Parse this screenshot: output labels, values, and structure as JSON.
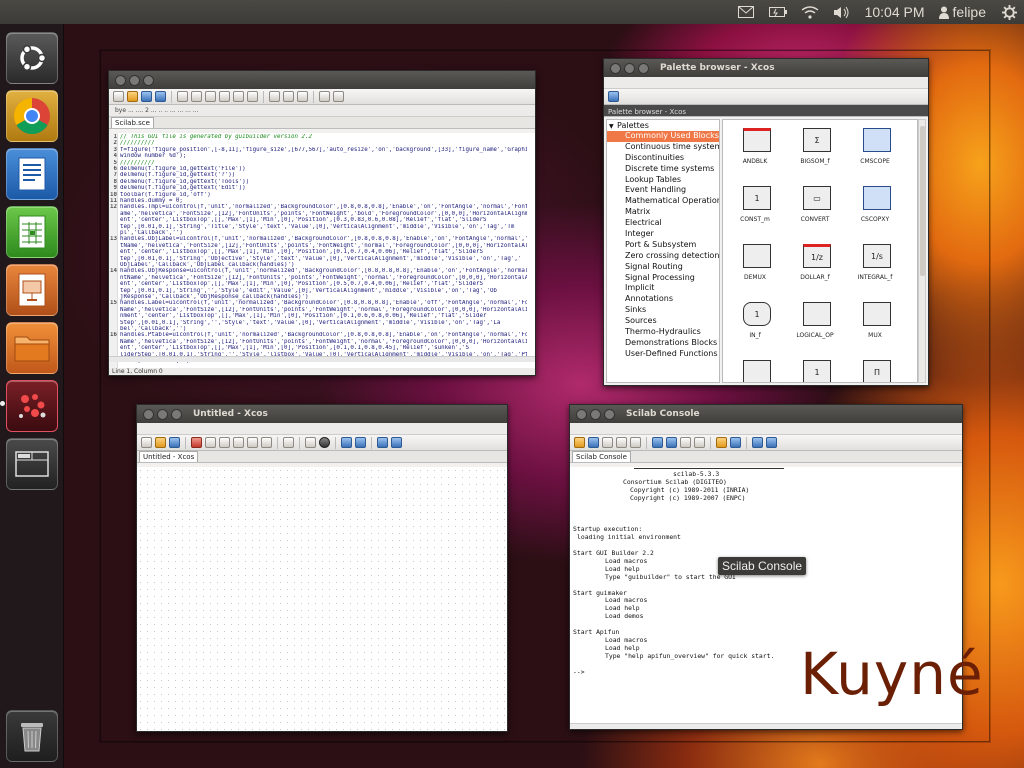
{
  "top_panel": {
    "clock": "10:04 PM",
    "user": "felipe",
    "indicators": [
      "mail-icon",
      "battery-icon",
      "wifi-icon",
      "volume-icon",
      "gear-icon"
    ]
  },
  "launcher": {
    "items": [
      "ubuntu-dash",
      "chromium",
      "libreoffice-writer",
      "libreoffice-calc",
      "libreoffice-impress",
      "files",
      "scilab",
      "workspace-switcher",
      "trash"
    ]
  },
  "scinotes": {
    "tab_label": "Scilab.sce",
    "path_text": "bye ... .... 2 ... .. .. ... ... ... ...",
    "status": "Line 1, Column 0",
    "lines": [
      {
        "n": "1",
        "text": "// This GUI file is generated by guibuilder version 2.2",
        "comment": true
      },
      {
        "n": "2",
        "text": "//////////",
        "comment": true
      },
      {
        "n": "3",
        "text": "f=figure('figure_position',[-8,11],'figure_size',[677,567],'auto_resize','on','background',[33],'figure_name','Graphic",
        "comment": false
      },
      {
        "n": "4",
        "text": "window number %d');",
        "comment": false
      },
      {
        "n": "5",
        "text": "//////////",
        "comment": true
      },
      {
        "n": "6",
        "text": "delmenu(f.figure_id,gettext('File'))",
        "comment": false
      },
      {
        "n": "7",
        "text": "delmenu(f.figure_id,gettext('?'))",
        "comment": false
      },
      {
        "n": "8",
        "text": "delmenu(f.figure_id,gettext('Tools'))",
        "comment": false
      },
      {
        "n": "9",
        "text": "delmenu(f.figure_id,gettext('Edit'))",
        "comment": false
      },
      {
        "n": "10",
        "text": "toolbar(f.figure_id,'off')",
        "comment": false
      },
      {
        "n": "11",
        "text": "handles.dummy = 0;",
        "comment": false
      },
      {
        "n": "12",
        "text": "handles.Tmpl=uicontrol(f,'unit','normalized','BackgroundColor',[0.8,0.8,0.8],'Enable','on','FontAngle','normal','FontN",
        "comment": false
      },
      {
        "n": "",
        "text": "ame','helvetica','FontSize',[12],'FontUnits','points','FontWeight','bold','ForegroundColor',[0,0,0],'HorizontalAlignm",
        "comment": false
      },
      {
        "n": "",
        "text": "ent','center','ListboxTop',[],'Max',[1],'Min',[0],'Position',[0.3,0.83,0.6,0.08],'Relief','flat','SliderS",
        "comment": false
      },
      {
        "n": "",
        "text": "tep',[0.01,0.1],'String','Title','Style','text','Value',[0],'VerticalAlignment','middle','Visible','on','Tag','Tm",
        "comment": false
      },
      {
        "n": "",
        "text": "pl','Callback','')",
        "comment": false
      },
      {
        "n": "13",
        "text": "handles.ObjLabel=uicontrol(f,'unit','normalized','BackgroundColor',[0.8,0.8,0.8],'Enable','on','FontAngle','normal','Fon",
        "comment": false
      },
      {
        "n": "",
        "text": "tName','helvetica','FontSize',[12],'FontUnits','points','FontWeight','normal','ForegroundColor',[0,0,0],'HorizontalAlignm",
        "comment": false
      },
      {
        "n": "",
        "text": "ent','center','ListboxTop',[],'Max',[1],'Min',[0],'Position',[0.1,0.7,0.4,0.06],'Relief','flat','SliderS",
        "comment": false
      },
      {
        "n": "",
        "text": "tep',[0.01,0.1],'String','Objective','Style','text','Value',[0],'VerticalAlignment','middle','Visible','on','Tag','",
        "comment": false
      },
      {
        "n": "",
        "text": "ObjLabel','Callback','ObjLabel_callback(handles)')",
        "comment": false
      },
      {
        "n": "14",
        "text": "handles.ObjResponse=uicontrol(f,'unit','normalized','BackgroundColor',[0.8,0.8,0.8],'Enable','on','FontAngle','normal','Fo",
        "comment": false
      },
      {
        "n": "",
        "text": "ntName','helvetica','FontSize',[12],'FontUnits','points','FontWeight','normal','ForegroundColor',[0,0,0],'HorizontalAlignm",
        "comment": false
      },
      {
        "n": "",
        "text": "ent','center','ListboxTop',[],'Max',[1],'Min',[0],'Position',[0.5,0.7,0.4,0.06],'Relief','flat','SliderS",
        "comment": false
      },
      {
        "n": "",
        "text": "tep',[0.01,0.1],'String','','Style','edit','Value',[0],'VerticalAlignment','middle','Visible','on','Tag','Ob",
        "comment": false
      },
      {
        "n": "",
        "text": "jResponse','Callback','ObjResponse_callback(handles)')",
        "comment": false
      },
      {
        "n": "15",
        "text": "handles.Label=uicontrol(f,'unit','normalized','BackgroundColor',[0.8,0.8,0.8],'Enable','off','FontAngle','normal','Font",
        "comment": false
      },
      {
        "n": "",
        "text": "Name','helvetica','FontSize',[12],'FontUnits','points','FontWeight','normal','ForegroundColor',[0,0,0],'HorizontalAlig",
        "comment": false
      },
      {
        "n": "",
        "text": "nment','center','ListboxTop',[],'Max',[1],'Min',[0],'Position',[0.1,0.6,0.8,0.06],'Relief','flat','Slider",
        "comment": false
      },
      {
        "n": "",
        "text": "Step',[0.01,0.1],'String','','Style','text','Value',[0],'VerticalAlignment','middle','Visible','on','Tag','La",
        "comment": false
      },
      {
        "n": "",
        "text": "bel','Callback','')",
        "comment": false
      },
      {
        "n": "16",
        "text": "handles.Ptable=uicontrol(f,'unit','normalized','BackgroundColor',[0.8,0.8,0.8],'Enable','on','FontAngle','normal','Font",
        "comment": false
      },
      {
        "n": "",
        "text": "Name','helvetica','FontSize',[12],'FontUnits','points','FontWeight','normal','ForegroundColor',[0,0,0],'HorizontalAlignm",
        "comment": false
      },
      {
        "n": "",
        "text": "ent','center','ListboxTop',[],'Max',[1],'Min',[0],'Position',[0.1,0.1,0.8,0.45],'Relief','sunken','S",
        "comment": false
      },
      {
        "n": "",
        "text": "liderStep',[0.01,0.1],'String','','Style','listbox','Value',[0],'VerticalAlignment','middle','Visible','on','Tag','Pt",
        "comment": false
      },
      {
        "n": "",
        "text": "able','Callback','')",
        "comment": false
      }
    ]
  },
  "palette": {
    "title": "Palette browser - Xcos",
    "breadcrumb": "Palette browser - Xcos",
    "tree_root": "Palettes",
    "tree_items": [
      "Commonly Used Blocks",
      "Continuous time systems",
      "Discontinuities",
      "Discrete time systems",
      "Lookup Tables",
      "Event Handling",
      "Mathematical Operations",
      "Matrix",
      "Electrical",
      "Integer",
      "Port & Subsystem",
      "Zero crossing detection",
      "Signal Routing",
      "Signal Processing",
      "Implicit",
      "Annotations",
      "Sinks",
      "Sources",
      "Thermo-Hydraulics",
      "Demonstrations Blocks",
      "User-Defined Functions"
    ],
    "blocks": [
      {
        "name": "ANDBLK",
        "glyph": ""
      },
      {
        "name": "BIGSOM_f",
        "glyph": "Σ"
      },
      {
        "name": "CMSCOPE",
        "glyph": ""
      },
      {
        "name": "CONST_m",
        "glyph": "1"
      },
      {
        "name": "CONVERT",
        "glyph": "▭"
      },
      {
        "name": "CSCOPXY",
        "glyph": ""
      },
      {
        "name": "DEMUX",
        "glyph": ""
      },
      {
        "name": "DOLLAR_f",
        "glyph": "1/z"
      },
      {
        "name": "INTEGRAL_f",
        "glyph": "1/s"
      },
      {
        "name": "IN_f",
        "glyph": "1"
      },
      {
        "name": "LOGICAL_OP",
        "glyph": ""
      },
      {
        "name": "MUX",
        "glyph": ""
      },
      {
        "name": "",
        "glyph": ""
      },
      {
        "name": "",
        "glyph": "1"
      },
      {
        "name": "",
        "glyph": "Π"
      }
    ]
  },
  "xcos": {
    "title": "Untitled - Xcos",
    "tab_label": "Untitled - Xcos"
  },
  "console": {
    "title": "Scilab Console",
    "tab_label": "Scilab Console",
    "tooltip": "Scilab Console",
    "lines": [
      {
        "col": 100,
        "text": "scilab-5.3.3"
      },
      {
        "col": 50,
        "text": "Consortium Scilab (DIGITEO)"
      },
      {
        "col": 57,
        "text": "Copyright (c) 1989-2011 (INRIA)"
      },
      {
        "col": 57,
        "text": "Copyright (c) 1989-2007 (ENPC)"
      },
      {
        "col": 0,
        "text": ""
      },
      {
        "col": 0,
        "text": ""
      },
      {
        "col": 0,
        "text": ""
      },
      {
        "col": 0,
        "text": "Startup execution:"
      },
      {
        "col": 4,
        "text": "loading initial environment"
      },
      {
        "col": 0,
        "text": ""
      },
      {
        "col": 0,
        "text": "Start GUI Builder 2.2"
      },
      {
        "col": 32,
        "text": "Load macros"
      },
      {
        "col": 32,
        "text": "Load help"
      },
      {
        "col": 32,
        "text": "Type \"guibuilder\" to start the GUI"
      },
      {
        "col": 0,
        "text": ""
      },
      {
        "col": 0,
        "text": "Start guimaker"
      },
      {
        "col": 32,
        "text": "Load macros"
      },
      {
        "col": 32,
        "text": "Load help"
      },
      {
        "col": 32,
        "text": "Load demos"
      },
      {
        "col": 0,
        "text": ""
      },
      {
        "col": 0,
        "text": "Start Apifun"
      },
      {
        "col": 32,
        "text": "Load macros"
      },
      {
        "col": 32,
        "text": "Load help"
      },
      {
        "col": 32,
        "text": "Type \"help apifun_overview\" for quick start."
      },
      {
        "col": 0,
        "text": ""
      },
      {
        "col": 0,
        "text": "-->"
      }
    ]
  },
  "watermark": "Kuyné"
}
